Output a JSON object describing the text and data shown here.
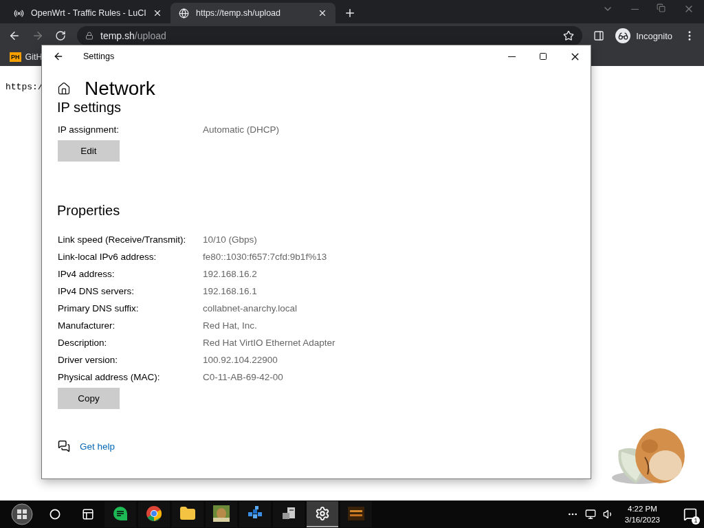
{
  "browser": {
    "tabs": [
      {
        "title": "OpenWrt - Traffic Rules - LuCI",
        "selected": false
      },
      {
        "title": "https://temp.sh/upload",
        "selected": true
      }
    ],
    "address": {
      "host": "temp.sh",
      "path": "/upload"
    },
    "profile": "Incognito",
    "bookmarks": [
      {
        "badge": "PH",
        "label": "GitH"
      }
    ],
    "page_text": "https:/"
  },
  "settings": {
    "title": "Settings",
    "heading": "Network",
    "ip_section": {
      "heading": "IP settings",
      "rows": [
        {
          "label": "IP assignment:",
          "value": "Automatic (DHCP)"
        }
      ],
      "button": "Edit"
    },
    "properties": {
      "heading": "Properties",
      "rows": [
        {
          "label": "Link speed (Receive/Transmit):",
          "value": "10/10 (Gbps)"
        },
        {
          "label": "Link-local IPv6 address:",
          "value": "fe80::1030:f657:7cfd:9b1f%13"
        },
        {
          "label": "IPv4 address:",
          "value": "192.168.16.2"
        },
        {
          "label": "IPv4 DNS servers:",
          "value": "192.168.16.1"
        },
        {
          "label": "Primary DNS suffix:",
          "value": "collabnet-anarchy.local"
        },
        {
          "label": "Manufacturer:",
          "value": "Red Hat, Inc."
        },
        {
          "label": "Description:",
          "value": "Red Hat VirtIO Ethernet Adapter"
        },
        {
          "label": "Driver version:",
          "value": "100.92.104.22900"
        },
        {
          "label": "Physical address (MAC):",
          "value": "C0-11-AB-69-42-00"
        }
      ],
      "button": "Copy"
    },
    "help_link": "Get help"
  },
  "taskbar": {
    "apps": [
      {
        "kind": "chat",
        "selected": false
      },
      {
        "kind": "chrome",
        "selected": false
      },
      {
        "kind": "folder",
        "selected": false
      },
      {
        "kind": "game",
        "selected": false
      },
      {
        "kind": "cubes",
        "selected": false
      },
      {
        "kind": "installer",
        "selected": false
      },
      {
        "kind": "gear",
        "selected": true
      },
      {
        "kind": "display",
        "selected": false
      }
    ],
    "time": "4:22 PM",
    "date": "3/16/2023",
    "notifications": "1"
  }
}
